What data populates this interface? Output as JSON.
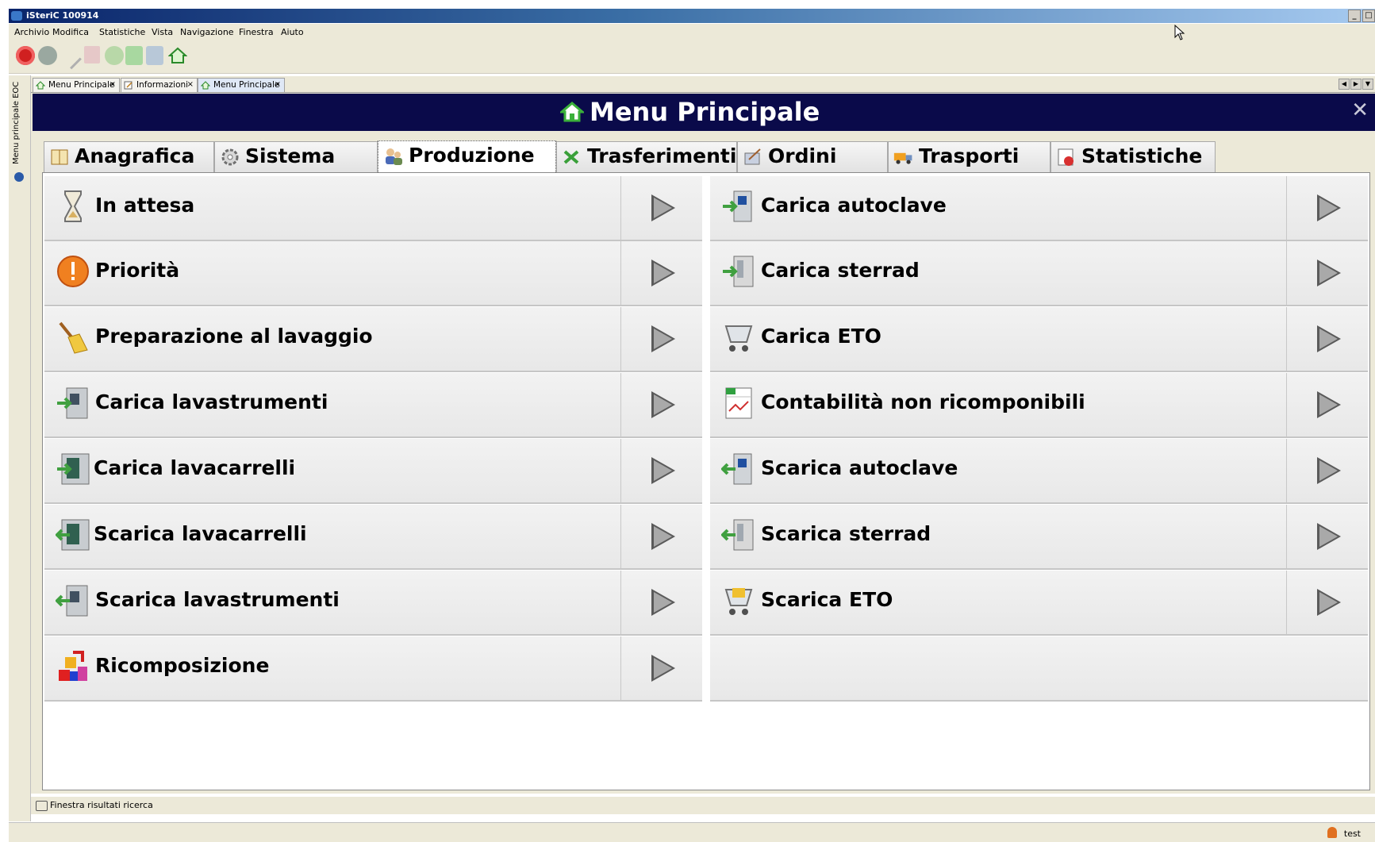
{
  "window": {
    "title": "iSteriC 100914"
  },
  "menubar": [
    "Archivio",
    "Modifica",
    "Statistiche",
    "Vista",
    "Navigazione",
    "Finestra",
    "Aiuto"
  ],
  "toolbar": {
    "buttons": [
      "stop-icon",
      "record-icon",
      "edit-icon",
      "delete-icon",
      "refresh-icon",
      "add-icon",
      "save-icon",
      "home-icon"
    ]
  },
  "sidebar": {
    "label": "Menu principale EOC"
  },
  "doc_tabs": [
    {
      "label": "Menu Principale",
      "icon": "home-icon"
    },
    {
      "label": "Informazioni",
      "icon": "note-icon"
    },
    {
      "label": "Menu Principale",
      "icon": "home-icon",
      "active": true
    }
  ],
  "header": {
    "title": "Menu Principale",
    "close": "✕"
  },
  "category_tabs": [
    {
      "label": "Anagrafica",
      "icon": "book-icon"
    },
    {
      "label": "Sistema",
      "icon": "gear-icon"
    },
    {
      "label": "Produzione",
      "icon": "users-icon",
      "active": true
    },
    {
      "label": "Trasferimenti",
      "icon": "transfer-icon"
    },
    {
      "label": "Ordini",
      "icon": "order-icon"
    },
    {
      "label": "Trasporti",
      "icon": "truck-icon"
    },
    {
      "label": "Statistiche",
      "icon": "chart-icon"
    }
  ],
  "menu_left": [
    {
      "label": "In attesa",
      "icon": "hourglass-icon"
    },
    {
      "label": "Priorità",
      "icon": "warning-icon"
    },
    {
      "label": "Preparazione al lavaggio",
      "icon": "broom-icon"
    },
    {
      "label": "Carica lavastrumenti",
      "icon": "washer-load-icon"
    },
    {
      "label": "Carica lavacarrelli",
      "icon": "cart-washer-load-icon"
    },
    {
      "label": "Scarica lavacarrelli",
      "icon": "cart-washer-unload-icon"
    },
    {
      "label": "Scarica lavastrumenti",
      "icon": "washer-unload-icon"
    },
    {
      "label": "Ricomposizione",
      "icon": "blocks-icon"
    }
  ],
  "menu_right": [
    {
      "label": "Carica autoclave",
      "icon": "autoclave-load-icon"
    },
    {
      "label": "Carica sterrad",
      "icon": "sterrad-load-icon"
    },
    {
      "label": "Carica ETO",
      "icon": "eto-load-icon"
    },
    {
      "label": "Contabilità non ricomponibili",
      "icon": "spreadsheet-icon"
    },
    {
      "label": "Scarica autoclave",
      "icon": "autoclave-unload-icon"
    },
    {
      "label": "Scarica sterrad",
      "icon": "sterrad-unload-icon"
    },
    {
      "label": "Scarica ETO",
      "icon": "eto-unload-icon"
    }
  ],
  "findbar": {
    "label": "Finestra risultati ricerca"
  },
  "status": {
    "user": "test"
  }
}
